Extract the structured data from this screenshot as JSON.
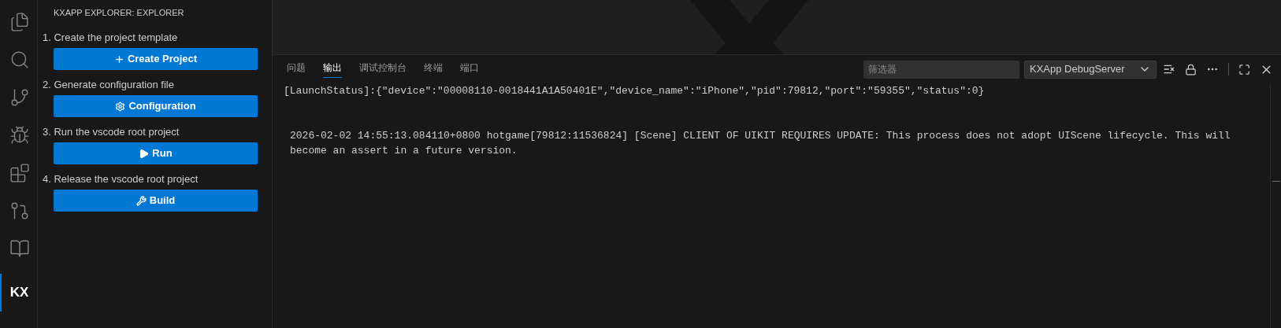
{
  "activity_bar": [
    {
      "kind": "files",
      "selected": false
    },
    {
      "kind": "search",
      "selected": false
    },
    {
      "kind": "branch",
      "selected": false
    },
    {
      "kind": "debug",
      "selected": false
    },
    {
      "kind": "blocks",
      "selected": false
    },
    {
      "kind": "graph",
      "selected": false
    },
    {
      "kind": "book",
      "selected": false
    },
    {
      "kind": "label",
      "label": "KX",
      "selected": true
    }
  ],
  "sidebar": {
    "title": "KXAPP EXPLORER: EXPLORER",
    "steps": [
      {
        "label": "1. Create the project template",
        "button": "Create Project",
        "kind": "plus"
      },
      {
        "label": "2. Generate configuration file",
        "button": "Configuration",
        "kind": "gear"
      },
      {
        "label": "3. Run the vscode root project",
        "button": "Run",
        "kind": "play"
      },
      {
        "label": "4. Release the vscode root project",
        "button": "Build",
        "kind": "tools"
      }
    ]
  },
  "panel": {
    "tabs": [
      {
        "label": "问题",
        "selected": false
      },
      {
        "label": "输出",
        "selected": true
      },
      {
        "label": "调试控制台",
        "selected": false
      },
      {
        "label": "终端",
        "selected": false
      },
      {
        "label": "端口",
        "selected": false
      }
    ],
    "filter": {
      "placeholder": "筛选器"
    },
    "channel": "KXApp DebugServer",
    "output": [
      {
        "kind": "status",
        "text": "[LaunchStatus]:{\"device\":\"00008110-0018441A1A50401E\",\"device_name\":\"iPhone\",\"pid\":79812,\"port\":\"59355\",\"status\":0}"
      },
      {
        "kind": "log",
        "text": "2026-02-02 14:55:13.084110+0800 hotgame[79812:11536824] [Scene] CLIENT OF UIKIT REQUIRES UPDATE: This process does not adopt UIScene lifecycle. This will become an assert in a future version."
      }
    ]
  }
}
